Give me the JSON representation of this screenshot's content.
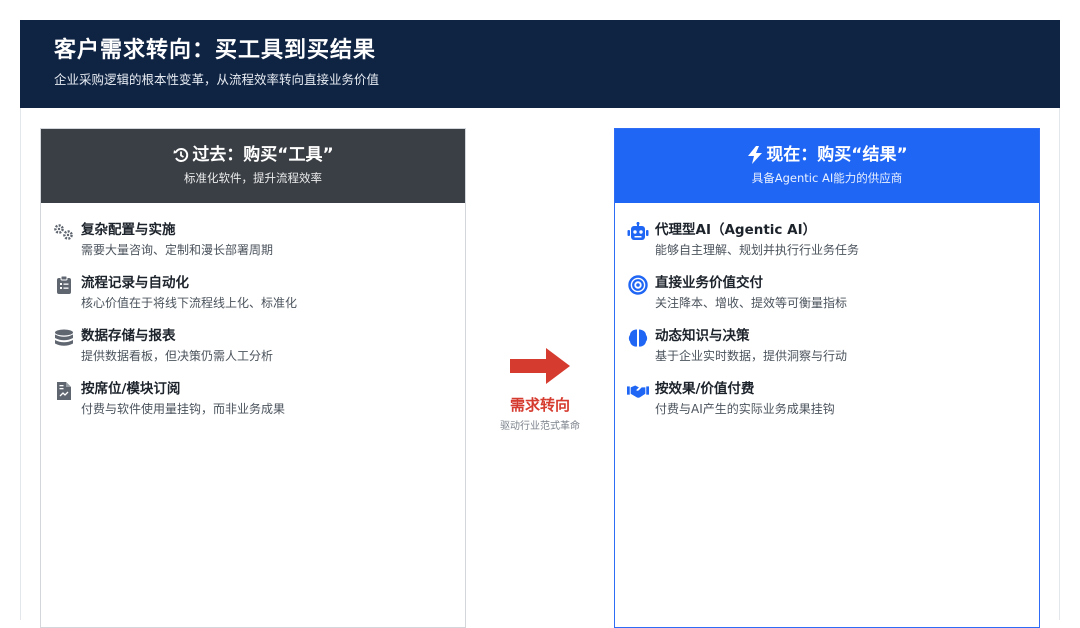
{
  "header": {
    "title": "客户需求转向：买工具到买结果",
    "subtitle": "企业采购逻辑的根本性变革，从流程效率转向直接业务价值"
  },
  "past": {
    "title": "过去：购买“工具”",
    "subtitle": "标准化软件，提升流程效率",
    "icon": "history-icon",
    "items": [
      {
        "icon": "gears-icon",
        "title": "复杂配置与实施",
        "desc": "需要大量咨询、定制和漫长部署周期"
      },
      {
        "icon": "clipboard-list-icon",
        "title": "流程记录与自动化",
        "desc": "核心价值在于将线下流程线上化、标准化"
      },
      {
        "icon": "database-icon",
        "title": "数据存储与报表",
        "desc": "提供数据看板，但决策仍需人工分析"
      },
      {
        "icon": "file-invoice-icon",
        "title": "按席位/模块订阅",
        "desc": "付费与软件使用量挂钩，而非业务成果"
      }
    ]
  },
  "present": {
    "title": "现在：购买“结果”",
    "subtitle": "具备Agentic AI能力的供应商",
    "icon": "bolt-icon",
    "items": [
      {
        "icon": "robot-icon",
        "title": "代理型AI（Agentic AI）",
        "desc": "能够自主理解、规划并执行行业务任务"
      },
      {
        "icon": "bullseye-icon",
        "title": "直接业务价值交付",
        "desc": "关注降本、增收、提效等可衡量指标"
      },
      {
        "icon": "brain-icon",
        "title": "动态知识与决策",
        "desc": "基于企业实时数据，提供洞察与行动"
      },
      {
        "icon": "handshake-icon",
        "title": "按效果/价值付费",
        "desc": "付费与AI产生的实际业务成果挂钩"
      }
    ]
  },
  "transition": {
    "icon": "arrow-right-icon",
    "label": "需求转向",
    "sub": "驱动行业范式革命"
  },
  "colors": {
    "header_bg": "#0f2342",
    "past_head": "#3a3f45",
    "present_head": "#1f66f5",
    "past_icon": "#5f6670",
    "present_icon": "#1f66f5",
    "accent_red": "#d63b2f"
  }
}
